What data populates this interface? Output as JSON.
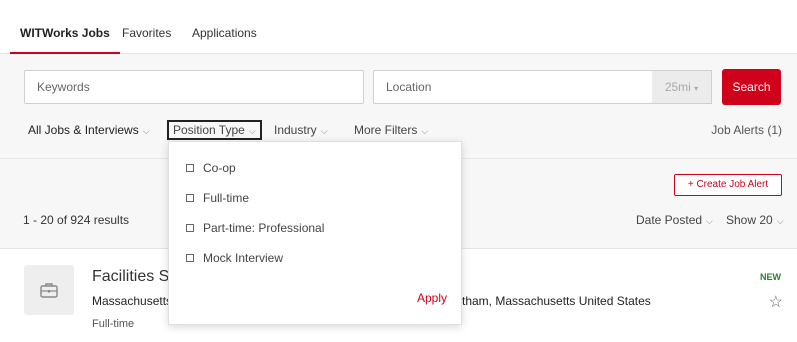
{
  "tabs": [
    {
      "label": "WITWorks Jobs",
      "active": true
    },
    {
      "label": "Favorites",
      "active": false
    },
    {
      "label": "Applications",
      "active": false
    }
  ],
  "search": {
    "keywords_placeholder": "Keywords",
    "location_placeholder": "Location",
    "radius": "25mi",
    "button_label": "Search"
  },
  "filters": {
    "all_jobs": "All Jobs & Interviews",
    "position_type": "Position Type",
    "industry": "Industry",
    "more_filters": "More Filters",
    "job_alerts": "Job Alerts (1)"
  },
  "results": {
    "create_alert_label": "+ Create Job Alert",
    "count": "1 - 20 of 924 results",
    "sort_label": "Date Posted",
    "show_label": "Show 20"
  },
  "job": {
    "title": "Facilities Se",
    "employer": "Massachusetts",
    "location": "tham, Massachusetts United States",
    "type": "Full-time",
    "badge": "NEW"
  },
  "dropdown": {
    "options": [
      "Co-op",
      "Full-time",
      "Part-time: Professional",
      "Mock Interview"
    ],
    "apply_label": "Apply"
  },
  "colors": {
    "accent": "#d0011b",
    "background": "#f7f7f7",
    "new_badge": "#2e7d32"
  }
}
